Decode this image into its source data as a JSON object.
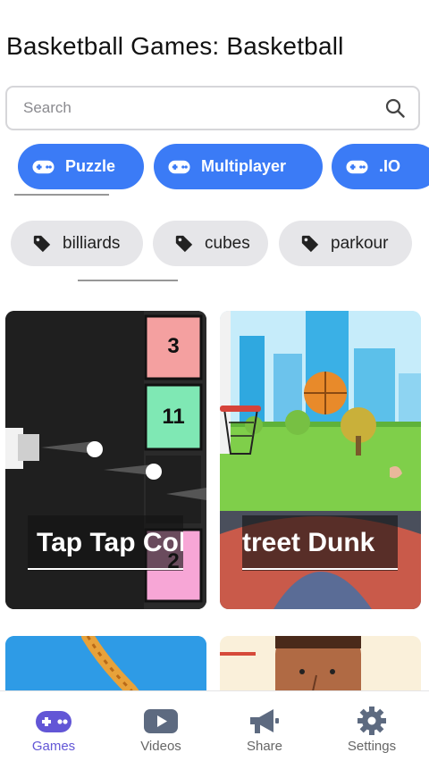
{
  "header": {
    "title": "Basketball Games:  Basketball"
  },
  "search": {
    "placeholder": "Search",
    "value": ""
  },
  "categories": [
    {
      "label": "Puzzle",
      "icon": "gamepad-icon"
    },
    {
      "label": "Multiplayer",
      "icon": "gamepad-icon"
    },
    {
      "label": ".IO",
      "icon": "gamepad-icon"
    }
  ],
  "tags": [
    {
      "label": "billiards",
      "icon": "tag-icon"
    },
    {
      "label": "cubes",
      "icon": "tag-icon"
    },
    {
      "label": "parkour",
      "icon": "tag-icon"
    }
  ],
  "games": [
    {
      "title": "Tap Tap Col",
      "block_numbers": [
        "3",
        "11",
        "2"
      ]
    },
    {
      "title": "treet Dunk"
    }
  ],
  "bottom_nav": [
    {
      "label": "Games",
      "icon": "gamepad-icon",
      "active": true
    },
    {
      "label": "Videos",
      "icon": "youtube-icon",
      "active": false
    },
    {
      "label": "Share",
      "icon": "megaphone-icon",
      "active": false
    },
    {
      "label": "Settings",
      "icon": "gear-icon",
      "active": false
    }
  ],
  "colors": {
    "accent": "#3b7bf6",
    "active_nav": "#6256d6",
    "tag_bg": "#e6e6e9",
    "inactive_nav": "#666666"
  }
}
